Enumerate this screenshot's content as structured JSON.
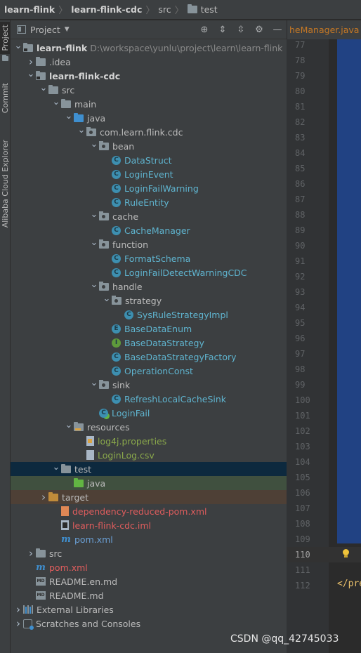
{
  "breadcrumb": {
    "items": [
      "learn-flink",
      "learn-flink-cdc",
      "src",
      "test"
    ]
  },
  "tool_stripe": {
    "tabs": [
      "Project",
      "Commit",
      "Alibaba Cloud Explorer"
    ]
  },
  "project_panel": {
    "title": "Project",
    "tool_icons": [
      "locate-icon",
      "expand-all-icon",
      "collapse-all-icon",
      "settings-icon",
      "hide-icon"
    ]
  },
  "tree": [
    {
      "label": "learn-flink",
      "path": "D:\\workspace\\yunlu\\project\\learn\\learn-flink",
      "icon": "module-folder-icon",
      "style": "bold",
      "level": 0,
      "arrow": "open"
    },
    {
      "label": ".idea",
      "icon": "folder-icon",
      "style": "normal",
      "level": 1,
      "arrow": "closed"
    },
    {
      "label": "learn-flink-cdc",
      "icon": "module-folder-icon",
      "style": "bold",
      "level": 1,
      "arrow": "open"
    },
    {
      "label": "src",
      "icon": "folder-icon",
      "style": "normal",
      "level": 2,
      "arrow": "open"
    },
    {
      "label": "main",
      "icon": "folder-icon",
      "style": "normal",
      "level": 3,
      "arrow": "open"
    },
    {
      "label": "java",
      "icon": "source-folder-icon",
      "style": "normal",
      "level": 4,
      "arrow": "open"
    },
    {
      "label": "com.learn.flink.cdc",
      "icon": "package-icon",
      "style": "normal",
      "level": 5,
      "arrow": "open"
    },
    {
      "label": "bean",
      "icon": "package-icon",
      "style": "normal",
      "level": 6,
      "arrow": "open"
    },
    {
      "label": "DataStruct",
      "icon": "class-icon",
      "style": "class",
      "level": 7,
      "arrow": "none"
    },
    {
      "label": "LoginEvent",
      "icon": "class-icon",
      "style": "class",
      "level": 7,
      "arrow": "none"
    },
    {
      "label": "LoginFailWarning",
      "icon": "class-icon",
      "style": "class",
      "level": 7,
      "arrow": "none"
    },
    {
      "label": "RuleEntity",
      "icon": "class-icon",
      "style": "class",
      "level": 7,
      "arrow": "none"
    },
    {
      "label": "cache",
      "icon": "package-icon",
      "style": "normal",
      "level": 6,
      "arrow": "open"
    },
    {
      "label": "CacheManager",
      "icon": "class-icon",
      "style": "class",
      "level": 7,
      "arrow": "none"
    },
    {
      "label": "function",
      "icon": "package-icon",
      "style": "normal",
      "level": 6,
      "arrow": "open"
    },
    {
      "label": "FormatSchema",
      "icon": "class-icon",
      "style": "class",
      "level": 7,
      "arrow": "none"
    },
    {
      "label": "LoginFailDetectWarningCDC",
      "icon": "class-icon",
      "style": "class",
      "level": 7,
      "arrow": "none"
    },
    {
      "label": "handle",
      "icon": "package-icon",
      "style": "normal",
      "level": 6,
      "arrow": "open"
    },
    {
      "label": "strategy",
      "icon": "package-icon",
      "style": "normal",
      "level": 7,
      "arrow": "open"
    },
    {
      "label": "SysRuleStrategyImpl",
      "icon": "class-icon",
      "style": "class",
      "level": 8,
      "arrow": "none"
    },
    {
      "label": "BaseDataEnum",
      "icon": "enum-icon",
      "style": "class",
      "level": 7,
      "arrow": "none"
    },
    {
      "label": "BaseDataStrategy",
      "icon": "interface-icon",
      "style": "class",
      "level": 7,
      "arrow": "none"
    },
    {
      "label": "BaseDataStrategyFactory",
      "icon": "class-icon",
      "style": "class",
      "level": 7,
      "arrow": "none"
    },
    {
      "label": "OperationConst",
      "icon": "class-icon",
      "style": "class",
      "level": 7,
      "arrow": "none"
    },
    {
      "label": "sink",
      "icon": "package-icon",
      "style": "normal",
      "level": 6,
      "arrow": "open"
    },
    {
      "label": "RefreshLocalCacheSink",
      "icon": "class-icon",
      "style": "class",
      "level": 7,
      "arrow": "none"
    },
    {
      "label": "LoginFail",
      "icon": "runnable-class-icon",
      "style": "class",
      "level": 6,
      "arrow": "none"
    },
    {
      "label": "resources",
      "icon": "resources-folder-icon",
      "style": "normal",
      "level": 4,
      "arrow": "open"
    },
    {
      "label": "log4j.properties",
      "icon": "properties-file-icon",
      "style": "prop",
      "level": 5,
      "arrow": "none"
    },
    {
      "label": "LoginLog.csv",
      "icon": "text-file-icon",
      "style": "prop",
      "level": 5,
      "arrow": "none"
    },
    {
      "label": "test",
      "icon": "folder-icon",
      "style": "normal",
      "level": 3,
      "arrow": "open",
      "state": "selected"
    },
    {
      "label": "java",
      "icon": "test-folder-icon",
      "style": "normal",
      "level": 4,
      "arrow": "none",
      "state": "green"
    },
    {
      "label": "target",
      "icon": "excluded-folder-icon",
      "style": "normal",
      "level": 2,
      "arrow": "closed",
      "state": "brown"
    },
    {
      "label": "dependency-reduced-pom.xml",
      "icon": "xml-file-icon",
      "style": "red",
      "level": 3,
      "arrow": "none"
    },
    {
      "label": "learn-flink-cdc.iml",
      "icon": "iml-file-icon",
      "style": "red",
      "level": 3,
      "arrow": "none"
    },
    {
      "label": "pom.xml",
      "icon": "maven-icon",
      "style": "blue",
      "level": 3,
      "arrow": "none"
    },
    {
      "label": "src",
      "icon": "folder-icon",
      "style": "normal",
      "level": 1,
      "arrow": "closed"
    },
    {
      "label": "pom.xml",
      "icon": "maven-icon",
      "style": "red",
      "level": 1,
      "arrow": "none"
    },
    {
      "label": "README.en.md",
      "icon": "markdown-icon",
      "style": "normal",
      "level": 1,
      "arrow": "none"
    },
    {
      "label": "README.md",
      "icon": "markdown-icon",
      "style": "normal",
      "level": 1,
      "arrow": "none"
    },
    {
      "label": "External Libraries",
      "icon": "libraries-icon",
      "style": "normal",
      "level": 0,
      "arrow": "closed"
    },
    {
      "label": "Scratches and Consoles",
      "icon": "scratches-icon",
      "style": "normal",
      "level": 0,
      "arrow": "closed"
    }
  ],
  "editor": {
    "tab_label": "heManager.java",
    "line_numbers": [
      "77",
      "78",
      "79",
      "80",
      "81",
      "82",
      "83",
      "84",
      "85",
      "86",
      "87",
      "88",
      "89",
      "90",
      "91",
      "92",
      "93",
      "94",
      "95",
      "96",
      "97",
      "98",
      "99",
      "100",
      "101",
      "102",
      "103",
      "104",
      "105",
      "106",
      "107",
      "108",
      "109",
      "110",
      "111",
      "112"
    ],
    "current_line": "110",
    "code_fragment": "</pre"
  },
  "watermark": "CSDN @qq_42745033"
}
